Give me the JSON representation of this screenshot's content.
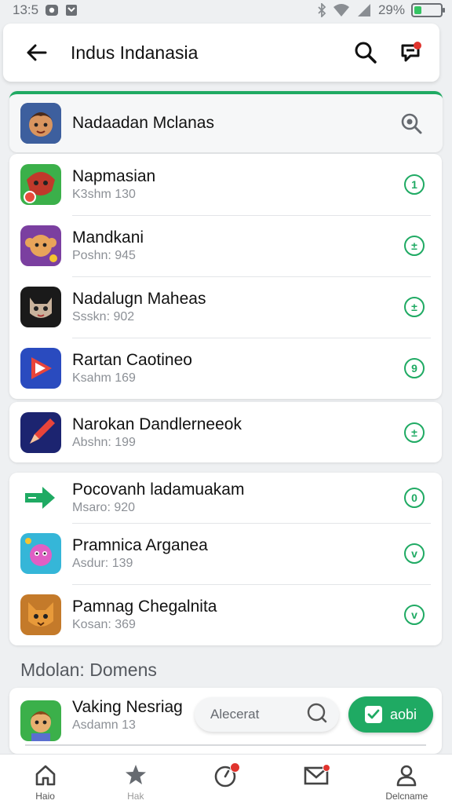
{
  "status_bar": {
    "time": "13:5",
    "battery": "29%",
    "battery_level": 0.29,
    "icons": [
      "gallery-icon",
      "notification-icon",
      "bluetooth-icon",
      "wifi-icon",
      "signal-icon",
      "battery-icon"
    ]
  },
  "header": {
    "title": "Indus Indanasia",
    "icons": [
      "back-arrow-icon",
      "search-icon",
      "chat-notification-icon"
    ]
  },
  "search_row": {
    "label": "Nadaadan Mclanas",
    "icon": "search-zoom-icon"
  },
  "list_groups": [
    {
      "items": [
        {
          "title": "Napmasian",
          "subtitle": "K3shm 130",
          "status": "1",
          "icon": "warrior-app-icon"
        },
        {
          "title": "Mandkani",
          "subtitle": "Poshn: 945",
          "status": "±",
          "icon": "monkey-app-icon"
        },
        {
          "title": "Nadalugn Maheas",
          "subtitle": "Ssskn: 902",
          "status": "±",
          "icon": "cat-app-icon"
        },
        {
          "title": "Rartan Caotineo",
          "subtitle": "Ksahm 169",
          "status": "9",
          "icon": "play-app-icon"
        }
      ]
    },
    {
      "items": [
        {
          "title": "Narokan Dandlerneeok",
          "subtitle": "Abshn: 199",
          "status": "±",
          "icon": "pen-app-icon"
        }
      ]
    },
    {
      "items": [
        {
          "title": "Pocovanh ladamuakam",
          "subtitle": "Msaro: 920",
          "status": "0",
          "icon": "arrow-app-icon"
        },
        {
          "title": "Pramnica Arganea",
          "subtitle": "Asdur: 139",
          "status": "v",
          "icon": "fairy-app-icon"
        },
        {
          "title": "Pamnag Chegalnita",
          "subtitle": "Kosan: 369",
          "status": "v",
          "icon": "fox-app-icon"
        }
      ]
    }
  ],
  "section": {
    "title": "Mdolan: Domens"
  },
  "bottom_item": {
    "title": "Vaking Nesriag",
    "subtitle": "Asdamn 13",
    "icon": "hero-app-icon",
    "input_placeholder": "Alecerat",
    "button_label": "aobi"
  },
  "nav": [
    {
      "label": "Haio",
      "icon": "home-icon"
    },
    {
      "label": "Hak",
      "icon": "star-icon"
    },
    {
      "label": "",
      "icon": "timer-icon"
    },
    {
      "label": "",
      "icon": "mail-icon"
    },
    {
      "label": "Delcname",
      "icon": "profile-icon"
    }
  ],
  "colors": {
    "accent": "#1faa63",
    "badge": "#e0342e"
  }
}
